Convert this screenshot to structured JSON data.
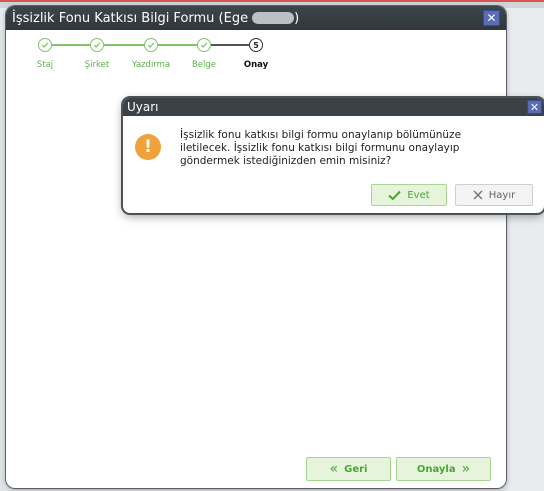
{
  "window": {
    "title": "İşsizlik Fonu Katkısı Bilgi Formu (Ege",
    "title_suffix": ")",
    "close_label": "✕"
  },
  "stepper": {
    "steps": [
      {
        "label": "Staj",
        "status": "completed"
      },
      {
        "label": "Şirket",
        "status": "completed"
      },
      {
        "label": "Yazdırma",
        "status": "completed"
      },
      {
        "label": "Belge",
        "status": "completed"
      },
      {
        "label": "Onay",
        "status": "current",
        "number": "5"
      }
    ]
  },
  "footer": {
    "back_label": "Geri",
    "back_icon": "«",
    "approve_label": "Onayla",
    "approve_icon": "»"
  },
  "dialog": {
    "title": "Uyarı",
    "close_label": "✕",
    "icon_glyph": "!",
    "message_line1": "İşsizlik fonu katkısı bilgi formu onaylanıp bölümünüze",
    "message_line2": "iletilecek. İşsizlik fonu katkısı bilgi formunu onaylayıp",
    "message_line3": "göndermek istediğinizden emin misiniz?",
    "yes_label": "Evet",
    "no_label": "Hayır"
  },
  "colors": {
    "accent_green": "#5cb14a",
    "warning_orange": "#f0a23a",
    "titlebar_dark": "#2f373c",
    "close_blue": "#5a6cb6"
  }
}
